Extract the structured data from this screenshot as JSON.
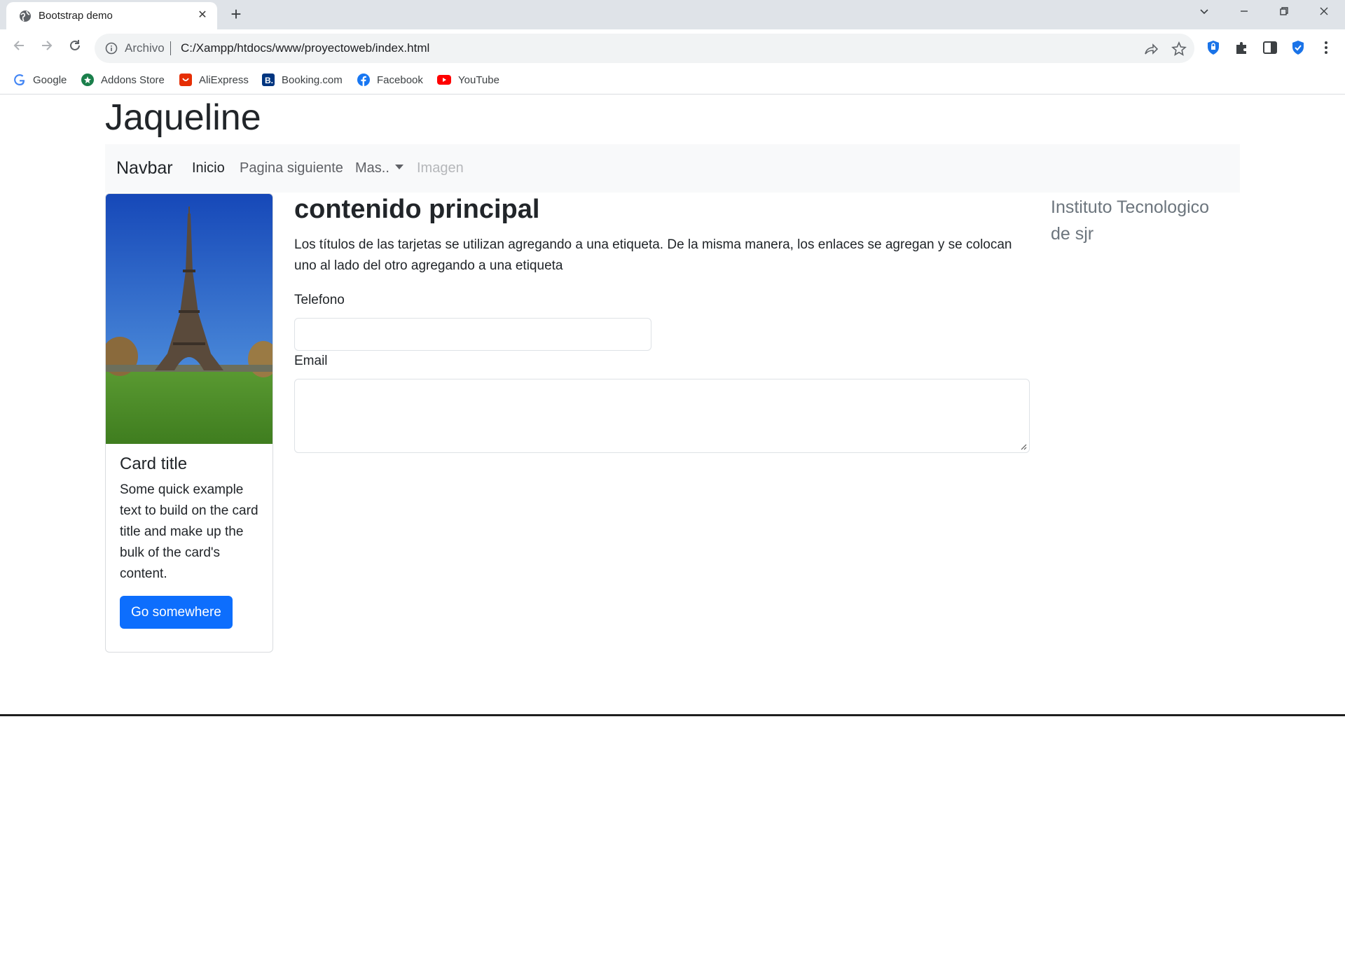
{
  "browser": {
    "tab_title": "Bootstrap demo",
    "tab_close": "✕",
    "new_tab": "+",
    "address": {
      "scheme": "Archivo",
      "url": "C:/Xampp/htdocs/www/proyectoweb/index.html"
    },
    "bookmarks": [
      {
        "label": "Google",
        "color": "#4285f4"
      },
      {
        "label": "Addons Store",
        "color": "#1a7f4b"
      },
      {
        "label": "AliExpress",
        "color": "#e62e04"
      },
      {
        "label": "Booking.com",
        "color": "#003580"
      },
      {
        "label": "Facebook",
        "color": "#1877f2"
      },
      {
        "label": "YouTube",
        "color": "#ff0000"
      }
    ]
  },
  "page": {
    "site_title": "Jaqueline",
    "navbar": {
      "brand": "Navbar",
      "links": [
        "Inicio",
        "Pagina siguiente",
        "Mas..",
        "Imagen"
      ]
    },
    "card": {
      "title": "Card title",
      "text": "Some quick example text to build on the card title and make up the bulk of the card's content.",
      "button": "Go somewhere",
      "accent": "#0d6efd"
    },
    "main": {
      "heading": "contenido principal",
      "text": "Los títulos de las tarjetas se utilizan agregando a una etiqueta. De la misma manera, los enlaces se agregan y se colocan uno al lado del otro agregando a una etiqueta",
      "phone_label": "Telefono",
      "phone_value": "",
      "email_label": "Email",
      "email_value": ""
    },
    "aside": "Instituto Tecnologico de sjr"
  }
}
